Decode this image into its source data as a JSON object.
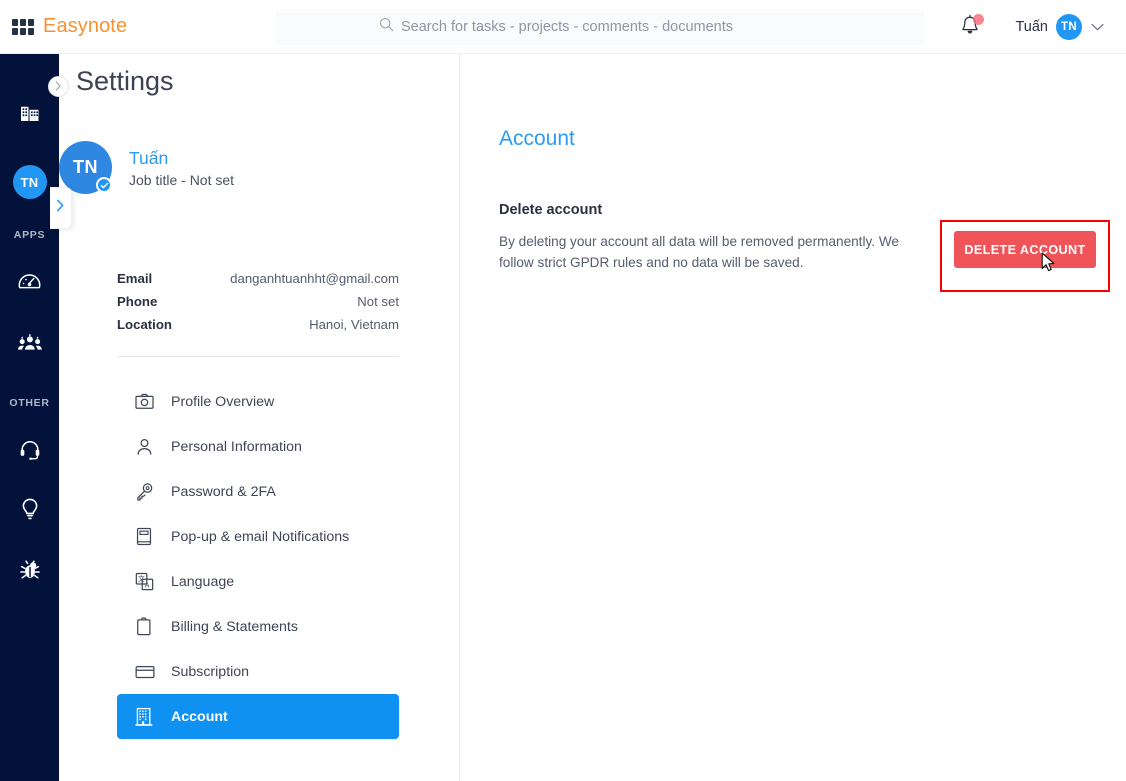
{
  "header": {
    "logo_icon": "app-grid-icon",
    "brand": "Easynote",
    "search": {
      "icon": "search-icon",
      "placeholder": "Search for tasks - projects - comments - documents",
      "value": ""
    },
    "notification_icon": "bell-icon",
    "has_notification_dot": true,
    "user_name": "Tuấn",
    "user_initials": "TN",
    "chevron_icon": "chevron-down-icon"
  },
  "leftnav": {
    "collapse_icon": "chevron-right-icon",
    "expand_icon": "chevron-right-icon",
    "workspace_icon": "building-icon",
    "avatar_initials": "TN",
    "section_apps": "APPS",
    "apps_icons": [
      "dashboard-icon",
      "people-group-icon"
    ],
    "section_other": "OTHER",
    "other_icons": [
      "headset-support-icon",
      "lightbulb-idea-icon",
      "bug-icon"
    ]
  },
  "settings": {
    "page_title": "Settings",
    "profile": {
      "initials": "TN",
      "verified_icon": "check-badge-icon",
      "name": "Tuấn",
      "job_title": "Job title - Not set"
    },
    "info": [
      {
        "key": "Email",
        "value": "danganhtuanhht@gmail.com"
      },
      {
        "key": "Phone",
        "value": "Not set"
      },
      {
        "key": "Location",
        "value": "Hanoi, Vietnam"
      }
    ],
    "menu": [
      {
        "icon": "camera-icon",
        "label": "Profile Overview",
        "active": false
      },
      {
        "icon": "person-icon",
        "label": "Personal Information",
        "active": false
      },
      {
        "icon": "key-icon",
        "label": "Password & 2FA",
        "active": false
      },
      {
        "icon": "notification-document-icon",
        "label": "Pop-up & email Notifications",
        "active": false
      },
      {
        "icon": "language-translate-icon",
        "label": "Language",
        "active": false
      },
      {
        "icon": "clipboard-icon",
        "label": "Billing & Statements",
        "active": false
      },
      {
        "icon": "credit-card-icon",
        "label": "Subscription",
        "active": false
      },
      {
        "icon": "building-icon",
        "label": "Account",
        "active": true
      }
    ]
  },
  "content": {
    "title": "Account",
    "section_title": "Delete account",
    "section_desc": "By deleting your account all data will be removed permanently. We follow strict GPDR rules and no data will be saved.",
    "delete_button": "DELETE ACCOUNT"
  },
  "colors": {
    "brand_orange": "#f79234",
    "accent_blue": "#0f91f2",
    "link_blue": "#2e9bf0",
    "nav_dark": "#03123b",
    "danger_red": "#ef5458",
    "highlight_border": "#f80000"
  }
}
